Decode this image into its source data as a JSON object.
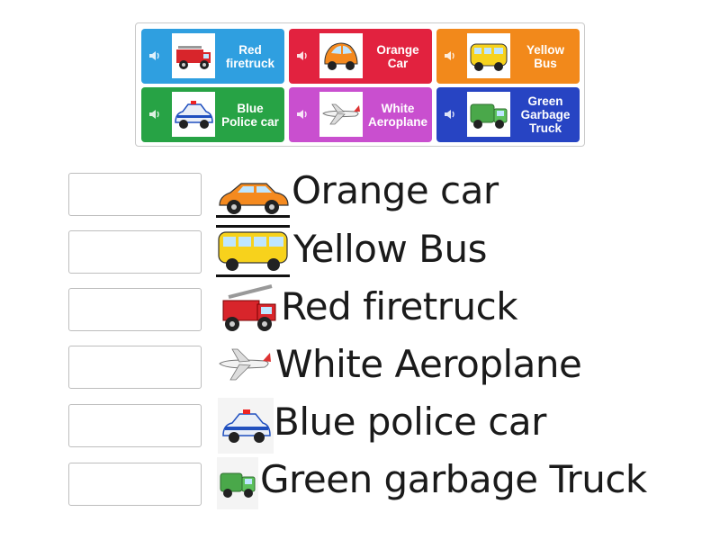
{
  "tiles": [
    {
      "label": "Red\nfiretruck",
      "color": "#2f9fe0",
      "icon": "firetruck-icon"
    },
    {
      "label": "Orange\nCar",
      "color": "#e2223f",
      "icon": "orange-car-icon"
    },
    {
      "label": "Yellow\nBus",
      "color": "#f2891b",
      "icon": "yellow-bus-icon"
    },
    {
      "label": "Blue\nPolice car",
      "color": "#27a345",
      "icon": "police-car-icon"
    },
    {
      "label": "White\nAeroplane",
      "color": "#c94fcf",
      "icon": "aeroplane-icon"
    },
    {
      "label": "Green\nGarbage\nTruck",
      "color": "#2744c3",
      "icon": "garbage-truck-icon"
    }
  ],
  "rows": [
    {
      "text": "Orange car",
      "icon": "orange-car-icon"
    },
    {
      "text": "Yellow Bus",
      "icon": "yellow-bus-icon"
    },
    {
      "text": "Red firetruck",
      "icon": "firetruck-icon"
    },
    {
      "text": "White Aeroplane",
      "icon": "aeroplane-icon"
    },
    {
      "text": "Blue police car",
      "icon": "police-car-icon"
    },
    {
      "text": "Green garbage Truck",
      "icon": "garbage-truck-icon"
    }
  ]
}
